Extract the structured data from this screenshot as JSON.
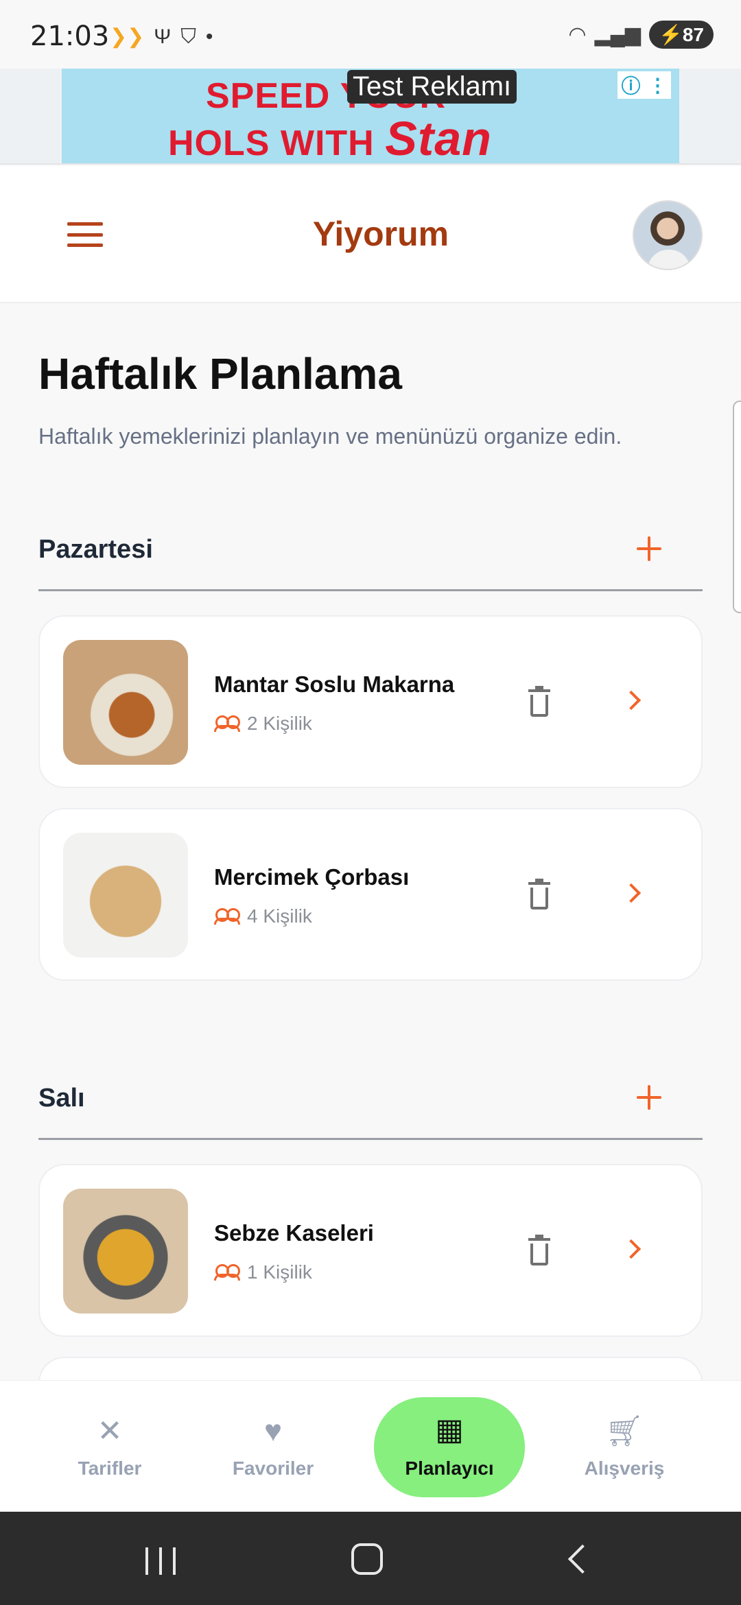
{
  "status_bar": {
    "time": "21:03",
    "battery": "87",
    "icons": [
      "notification-icon",
      "usb-icon",
      "shield-icon",
      "dot-icon",
      "wifi-icon",
      "signal-icon",
      "battery-icon"
    ]
  },
  "ad": {
    "label": "Test Reklamı",
    "line1": "SPEED YOUR",
    "line2": "HOLS WITH",
    "brand": "Stan",
    "info_icon": "info-icon",
    "more_icon": "more-vertical-icon"
  },
  "header": {
    "title": "Yiyorum",
    "menu_icon": "hamburger-menu-icon",
    "avatar": "user-avatar"
  },
  "page": {
    "title": "Haftalık Planlama",
    "subtitle": "Haftalık yemeklerinizi planlayın ve menünüzü organize edin."
  },
  "days": [
    {
      "name": "Pazartesi",
      "meals": [
        {
          "name": "Mantar Soslu Makarna",
          "servings": "2 Kişilik"
        },
        {
          "name": "Mercimek Çorbası",
          "servings": "4 Kişilik"
        }
      ]
    },
    {
      "name": "Salı",
      "meals": [
        {
          "name": "Sebze Kaseleri",
          "servings": "1 Kişilik"
        }
      ]
    }
  ],
  "bottom_nav": {
    "items": [
      {
        "label": "Tarifler",
        "icon": "utensils-icon"
      },
      {
        "label": "Favoriler",
        "icon": "heart-icon"
      },
      {
        "label": "Planlayıcı",
        "icon": "calendar-icon",
        "active": true
      },
      {
        "label": "Alışveriş",
        "icon": "cart-icon"
      }
    ]
  },
  "colors": {
    "accent": "#f0642a",
    "brand": "#a33a10",
    "active_nav": "#86ef7e"
  }
}
